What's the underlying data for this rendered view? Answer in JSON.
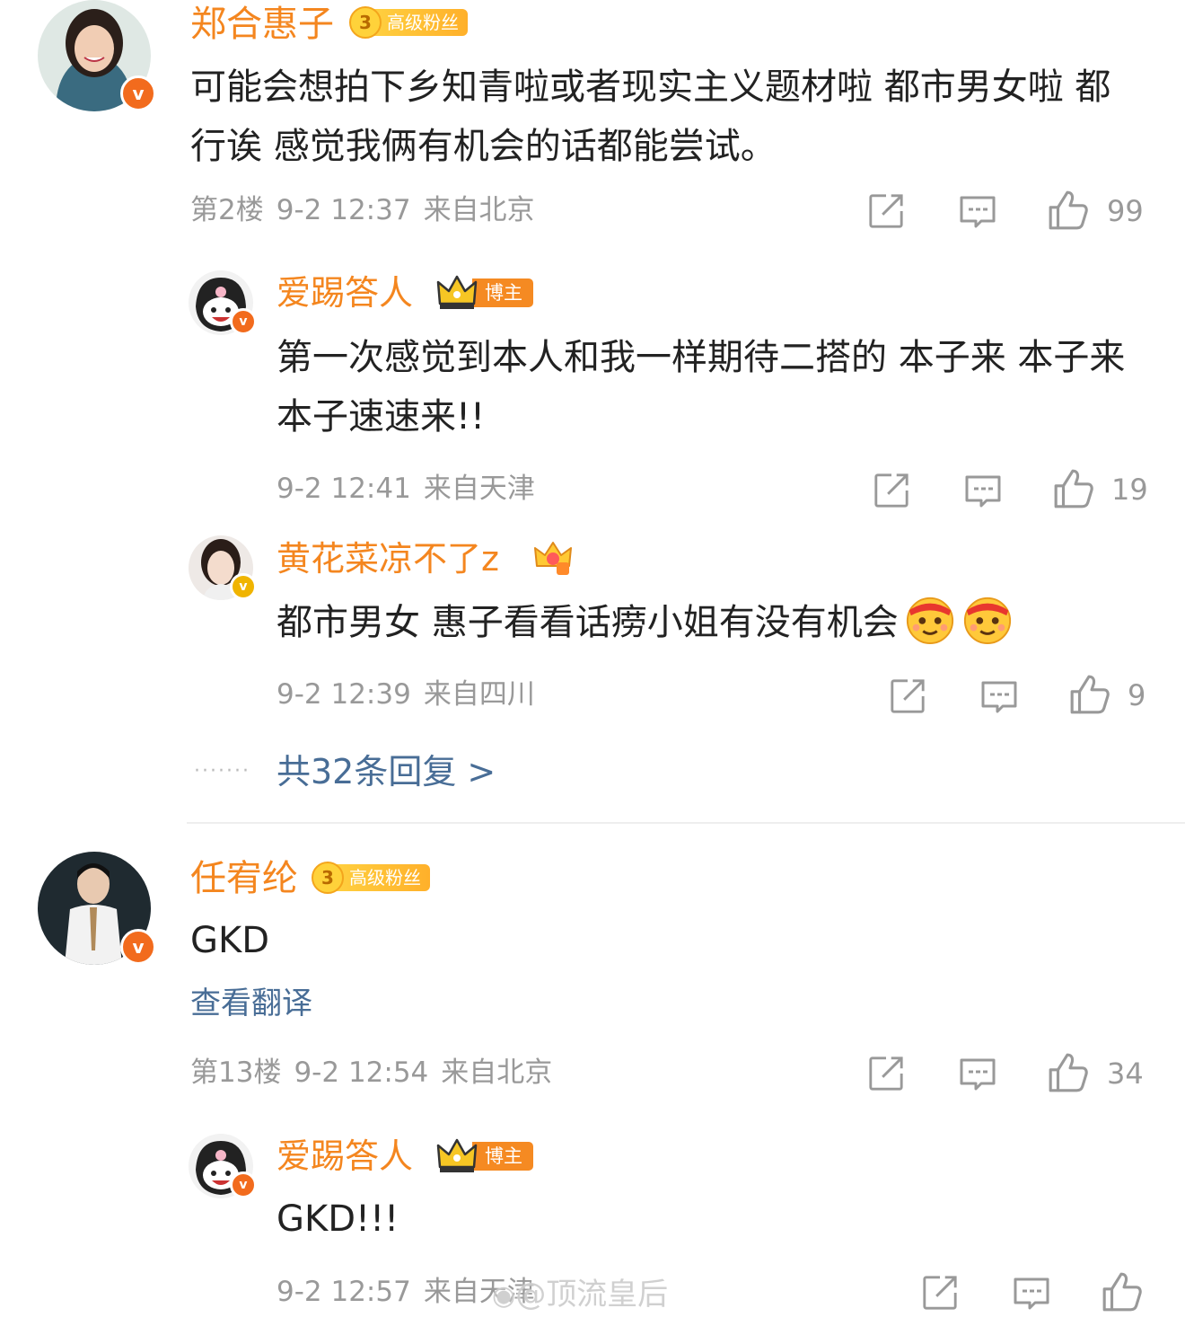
{
  "comments": [
    {
      "username": "郑合惠子",
      "badge_level": "3",
      "badge_label": "高级粉丝",
      "text": "可能会想拍下乡知青啦或者现实主义题材啦 都市男女啦 都行诶 感觉我俩有机会的话都能尝试。",
      "floor": "第2楼",
      "time": "9-2 12:37",
      "location": "来自北京",
      "likes": "99",
      "replies": [
        {
          "username": "爱踢答人",
          "badge_label": "博主",
          "text": "第一次感觉到本人和我一样期待二搭的 本子来 本子来 本子速速来!!",
          "time": "9-2 12:41",
          "location": "来自天津",
          "likes": "19"
        },
        {
          "username": "黄花菜凉不了z",
          "text": "都市男女 惠子看看话痨小姐有没有机会",
          "time": "9-2 12:39",
          "location": "来自四川",
          "likes": "9"
        }
      ],
      "more_replies": "共32条回复 >"
    },
    {
      "username": "任宥纶",
      "badge_level": "3",
      "badge_label": "高级粉丝",
      "text": "GKD",
      "translate": "查看翻译",
      "floor": "第13楼",
      "time": "9-2 12:54",
      "location": "来自北京",
      "likes": "34",
      "replies": [
        {
          "username": "爱踢答人",
          "badge_label": "博主",
          "text": "GKD!!!",
          "time": "9-2 12:57",
          "location": "来自天津"
        }
      ]
    }
  ],
  "watermark": "@顶流皇后",
  "colors": {
    "username": "#f4861f",
    "meta": "#999999",
    "link": "#486d96",
    "verified_badge": "#f26b1d"
  },
  "icons": [
    "share-icon",
    "comment-icon",
    "like-icon",
    "verified-v-icon",
    "crown-icon",
    "emoji-sticker-icon"
  ]
}
